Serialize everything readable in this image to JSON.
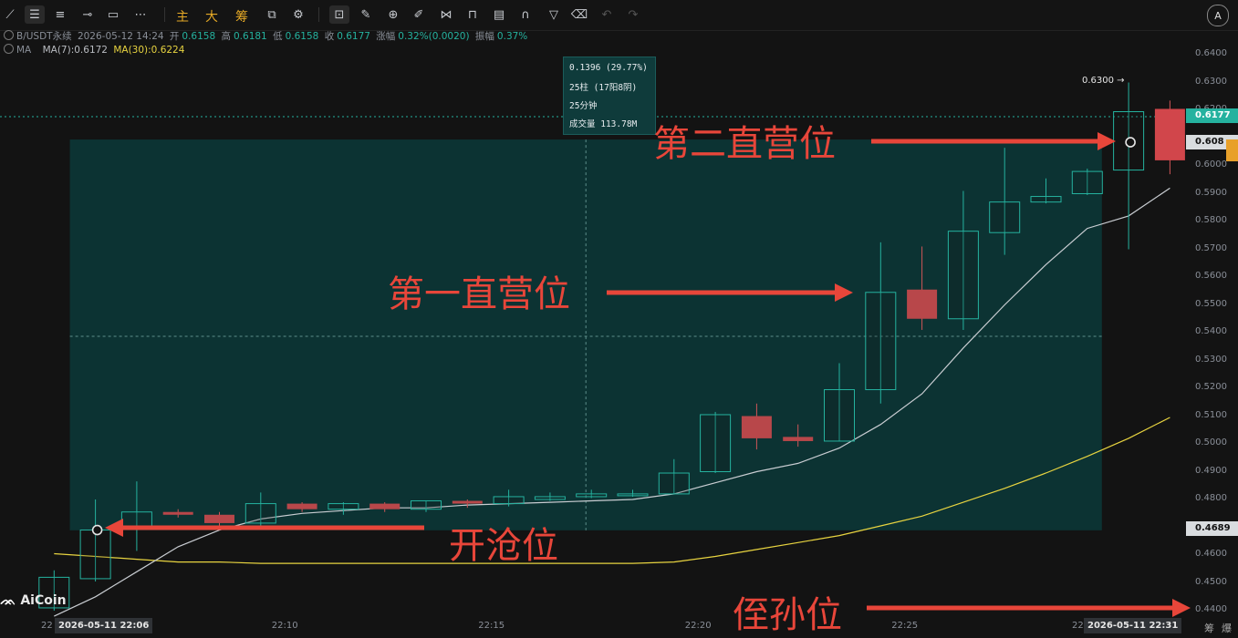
{
  "toolbar": {
    "text_buttons": [
      "主",
      "大",
      "筹"
    ],
    "icons": [
      "trend-line-icon",
      "parallel-line-icon",
      "horizontal-line-icon",
      "ray-icon",
      "rectangle-icon",
      "more-dots-icon",
      "copy-layout-icon",
      "ruler-icon",
      "zoom-in-icon",
      "brush-icon",
      "pattern-icon",
      "lock-icon",
      "note-icon",
      "magnet-icon",
      "filter-icon",
      "trash-icon",
      "undo-icon",
      "redo-icon",
      "translate-icon"
    ],
    "translate_label": "A"
  },
  "info_bar": {
    "symbol": "B/USDT永续",
    "datetime": "2026-05-12 14:24",
    "open_label": "开",
    "open": "0.6158",
    "high_label": "高",
    "high": "0.6181",
    "low_label": "低",
    "low": "0.6158",
    "close_label": "收",
    "close": "0.6177",
    "change_label": "涨幅",
    "change": "0.32%(0.0020)",
    "amplitude_label": "振幅",
    "amplitude": "0.37%",
    "ma_label": "MA",
    "ma7": "MA(7):0.6172",
    "ma30": "MA(30):0.6224"
  },
  "tooltip": {
    "line1": "0.1396 (29.77%)",
    "line2": "25柱 (17阳8阴)",
    "line3": "25分钟",
    "line4": "成交量 113.78M"
  },
  "annotations": {
    "second": "第二直营位",
    "first": "第一直营位",
    "open": "开沧位",
    "stop": "侄孙位"
  },
  "logo": "AiCoin",
  "price_tags": {
    "high_mark": "0.6300",
    "last": "0.6177",
    "current": "0.608",
    "range_low": "0.4689"
  },
  "x_boxes": {
    "start": "2026-05-11 22:06",
    "end": "2026-05-11 22:31"
  },
  "x_partial": {
    "left": "22",
    "right": "22"
  },
  "footer": {
    "chip1": "筹",
    "chip2": "爆"
  },
  "colors": {
    "up": "#25b29f",
    "down": "#b8474a",
    "ma7": "#c9cdd2",
    "ma30": "#e8d440",
    "range_fill": "#0c3535",
    "arrow": "#e8463a"
  },
  "chart_data": {
    "type": "candlestick",
    "interval": "1m",
    "ylim": [
      0.435,
      0.645
    ],
    "y_ticks": [
      0.64,
      0.63,
      0.62,
      0.61,
      0.6,
      0.59,
      0.58,
      0.57,
      0.56,
      0.55,
      0.54,
      0.53,
      0.52,
      0.51,
      0.5,
      0.49,
      0.48,
      0.47,
      0.46,
      0.45,
      0.44
    ],
    "y_tick_labels": [
      "0.6400",
      "0.6300",
      "0.6200",
      "",
      "0.6000",
      "0.5900",
      "0.5800",
      "0.5700",
      "0.5600",
      "0.5500",
      "0.5400",
      "0.5300",
      "0.5200",
      "0.5100",
      "0.5000",
      "0.4900",
      "0.4800",
      "",
      "0.4600",
      "0.4500",
      "0.4400"
    ],
    "x_tick_labels": [
      {
        "index": 3,
        "label": "22:10"
      },
      {
        "index": 8,
        "label": "22:15"
      },
      {
        "index": 13,
        "label": "22:20"
      },
      {
        "index": 18,
        "label": "22:25"
      }
    ],
    "candles": [
      {
        "t": "22:05",
        "o": 0.441,
        "h": 0.4545,
        "l": 0.44,
        "c": 0.452
      },
      {
        "t": "22:06",
        "o": 0.4515,
        "h": 0.48,
        "l": 0.4505,
        "c": 0.469
      },
      {
        "t": "22:07",
        "o": 0.47,
        "h": 0.4865,
        "l": 0.4615,
        "c": 0.4755
      },
      {
        "t": "22:08",
        "o": 0.4755,
        "h": 0.4765,
        "l": 0.4735,
        "c": 0.4745
      },
      {
        "t": "22:09",
        "o": 0.4745,
        "h": 0.4755,
        "l": 0.4705,
        "c": 0.4715
      },
      {
        "t": "22:10",
        "o": 0.4715,
        "h": 0.4825,
        "l": 0.47,
        "c": 0.4785
      },
      {
        "t": "22:11",
        "o": 0.4785,
        "h": 0.479,
        "l": 0.4755,
        "c": 0.4765
      },
      {
        "t": "22:12",
        "o": 0.4765,
        "h": 0.479,
        "l": 0.4745,
        "c": 0.4785
      },
      {
        "t": "22:13",
        "o": 0.4785,
        "h": 0.479,
        "l": 0.4755,
        "c": 0.4765
      },
      {
        "t": "22:14",
        "o": 0.4765,
        "h": 0.4795,
        "l": 0.4755,
        "c": 0.4795
      },
      {
        "t": "22:15",
        "o": 0.4795,
        "h": 0.48,
        "l": 0.477,
        "c": 0.4785
      },
      {
        "t": "22:16",
        "o": 0.4785,
        "h": 0.4835,
        "l": 0.4775,
        "c": 0.481
      },
      {
        "t": "22:17",
        "o": 0.48,
        "h": 0.4825,
        "l": 0.4795,
        "c": 0.481
      },
      {
        "t": "22:18",
        "o": 0.481,
        "h": 0.4835,
        "l": 0.4805,
        "c": 0.482
      },
      {
        "t": "22:19",
        "o": 0.482,
        "h": 0.4835,
        "l": 0.481,
        "c": 0.482
      },
      {
        "t": "22:20",
        "o": 0.482,
        "h": 0.4945,
        "l": 0.482,
        "c": 0.4895
      },
      {
        "t": "22:21",
        "o": 0.49,
        "h": 0.5115,
        "l": 0.4895,
        "c": 0.5105
      },
      {
        "t": "22:22",
        "o": 0.51,
        "h": 0.5145,
        "l": 0.498,
        "c": 0.502
      },
      {
        "t": "22:23",
        "o": 0.5025,
        "h": 0.507,
        "l": 0.499,
        "c": 0.501
      },
      {
        "t": "22:24",
        "o": 0.501,
        "h": 0.529,
        "l": 0.501,
        "c": 0.5195
      },
      {
        "t": "22:25",
        "o": 0.5195,
        "h": 0.5725,
        "l": 0.5145,
        "c": 0.5545
      },
      {
        "t": "22:26",
        "o": 0.5555,
        "h": 0.571,
        "l": 0.541,
        "c": 0.545
      },
      {
        "t": "22:27",
        "o": 0.545,
        "h": 0.591,
        "l": 0.541,
        "c": 0.5765
      },
      {
        "t": "22:28",
        "o": 0.576,
        "h": 0.6065,
        "l": 0.568,
        "c": 0.587
      },
      {
        "t": "22:29",
        "o": 0.587,
        "h": 0.5955,
        "l": 0.5865,
        "c": 0.589
      },
      {
        "t": "22:30",
        "o": 0.59,
        "h": 0.599,
        "l": 0.5895,
        "c": 0.598
      },
      {
        "t": "22:31",
        "o": 0.5985,
        "h": 0.63,
        "l": 0.57,
        "c": 0.6195
      },
      {
        "t": "22:32",
        "o": 0.6205,
        "h": 0.6235,
        "l": 0.597,
        "c": 0.602
      }
    ],
    "ma7": [
      0.438,
      0.445,
      0.454,
      0.463,
      0.469,
      0.473,
      0.475,
      0.476,
      0.477,
      0.477,
      0.478,
      0.4785,
      0.479,
      0.4795,
      0.48,
      0.482,
      0.486,
      0.49,
      0.493,
      0.4985,
      0.507,
      0.518,
      0.5345,
      0.55,
      0.5645,
      0.5775,
      0.582,
      0.592
    ],
    "ma30": [
      0.4605,
      0.4595,
      0.4585,
      0.4575,
      0.4575,
      0.457,
      0.457,
      0.457,
      0.457,
      0.457,
      0.457,
      0.457,
      0.457,
      0.457,
      0.457,
      0.4575,
      0.4595,
      0.462,
      0.4645,
      0.467,
      0.4705,
      0.474,
      0.479,
      0.484,
      0.4895,
      0.4955,
      0.502,
      0.5095
    ],
    "range": {
      "low": 0.4689,
      "high": 0.6085,
      "start_index": 2,
      "end_index": 26
    },
    "markers": [
      {
        "index": 1,
        "price": 0.469,
        "label": "开沧位"
      },
      {
        "index": 26,
        "price": 0.6085,
        "label": "第二直营位"
      }
    ]
  }
}
